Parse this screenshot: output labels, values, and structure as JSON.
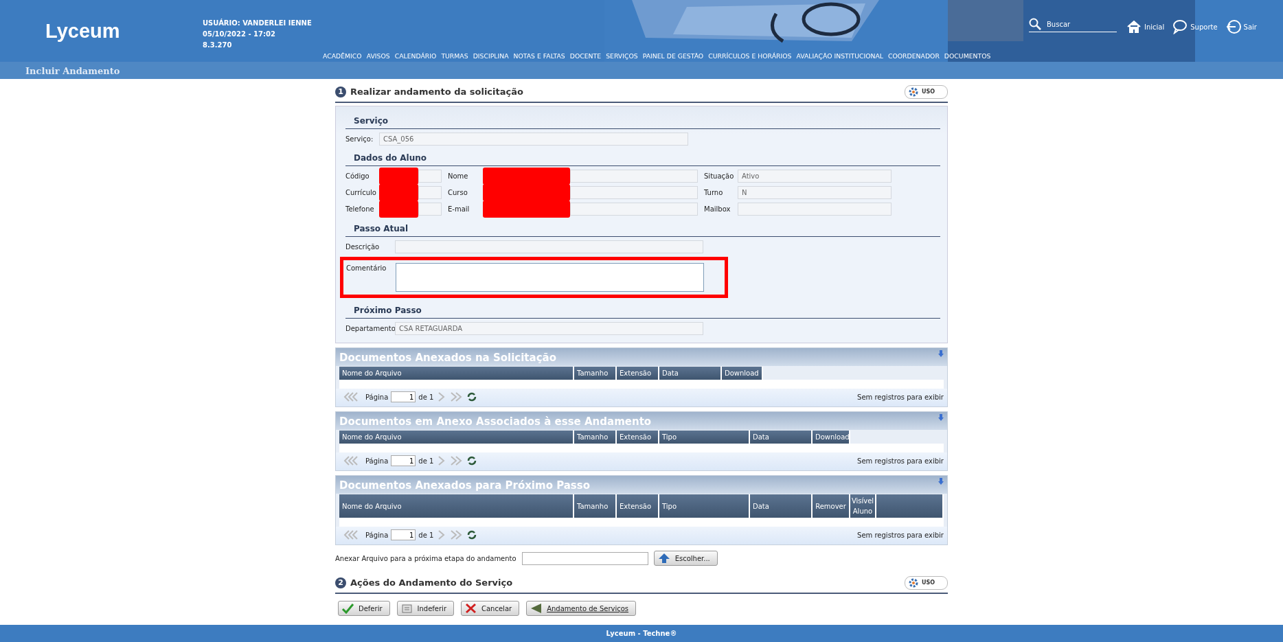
{
  "header": {
    "logo": "Lyceum",
    "user_label": "USUÁRIO:",
    "user_name": "VANDERLEI IENNE",
    "datetime": "05/10/2022 - 17:02",
    "version": "8.3.270",
    "search": {
      "placeholder": "Buscar"
    },
    "links": [
      {
        "kind": "home",
        "label": "Inicial"
      },
      {
        "kind": "chat",
        "label": "Suporte"
      },
      {
        "kind": "exit",
        "label": "Sair"
      }
    ],
    "menu": [
      "ACADÊMICO",
      "AVISOS",
      "CALENDÁRIO",
      "TURMAS",
      "DISCIPLINA",
      "NOTAS E FALTAS",
      "DOCENTE",
      "SERVIÇOS",
      "PAINEL DE GESTÃO",
      "CURRÍCULOS E HORÁRIOS",
      "AVALIAÇÃO INSTITUCIONAL",
      "COORDENADOR",
      "DOCUMENTOS"
    ]
  },
  "page_title": "Incluir Andamento",
  "section1": {
    "number": "1",
    "title": "Realizar andamento da solicitação",
    "uso": "USO",
    "groups": [
      {
        "title": "Serviço",
        "kind": "single",
        "fields": [
          {
            "label": "Serviço:",
            "value": "CSA_056"
          }
        ]
      },
      {
        "title": "Dados do Aluno",
        "kind": "grid",
        "fields": [
          {
            "label": "Código",
            "redacted": true
          },
          {
            "label": "Nome",
            "redacted": true
          },
          {
            "label": "Situação",
            "value": "Ativo"
          },
          {
            "label": "Currículo",
            "redacted": true
          },
          {
            "label": "Curso",
            "redacted": true
          },
          {
            "label": "Turno",
            "value": "N"
          },
          {
            "label": "Telefone",
            "redacted": true
          },
          {
            "label": "E-mail",
            "redacted": true
          },
          {
            "label": "Mailbox"
          }
        ]
      },
      {
        "title": "Passo Atual",
        "kind": "single",
        "fields": [
          {
            "label": "Descrição"
          },
          {
            "label": "Comentário",
            "kind": "textarea",
            "highlighted": true
          }
        ]
      },
      {
        "title": "Próximo Passo",
        "kind": "single",
        "fields": [
          {
            "label": "Departamento",
            "value": "CSA RETAGUARDA"
          }
        ]
      }
    ]
  },
  "tables": [
    {
      "title": "Documentos Anexados na Solicitação",
      "columns": [
        "Nome do Arquivo",
        "Tamanho",
        "Extensão",
        "Data",
        "Download"
      ],
      "pager": {
        "label": "Página",
        "page": "1",
        "of": "de 1",
        "empty": "Sem registros para exibir"
      }
    },
    {
      "title": "Documentos em Anexo Associados à esse Andamento",
      "columns": [
        "Nome do Arquivo",
        "Tamanho",
        "Extensão",
        "Tipo",
        "Data",
        "Download"
      ],
      "pager": {
        "label": "Página",
        "page": "1",
        "of": "de 1",
        "empty": "Sem registros para exibir"
      }
    },
    {
      "title": "Documentos Anexados para Próximo Passo",
      "columns": [
        "Nome do Arquivo",
        "Tamanho",
        "Extensão",
        "Tipo",
        "Data",
        "Remover",
        "Visível Aluno"
      ],
      "filler": true,
      "pager": {
        "label": "Página",
        "page": "1",
        "of": "de 1",
        "empty": "Sem registros para exibir"
      }
    }
  ],
  "attach": {
    "label": "Anexar Arquivo para a próxima etapa do andamento",
    "button": "Escolher..."
  },
  "section2": {
    "number": "2",
    "title": "Ações do Andamento do Serviço",
    "uso": "USO",
    "buttons": [
      {
        "kind": "approve",
        "label": "Deferir"
      },
      {
        "kind": "reject",
        "label": "Indeferir"
      },
      {
        "kind": "cancel",
        "label": "Cancelar"
      },
      {
        "kind": "back",
        "label": "Andamento de Serviços"
      }
    ]
  },
  "footer": "Lyceum - Techne®"
}
